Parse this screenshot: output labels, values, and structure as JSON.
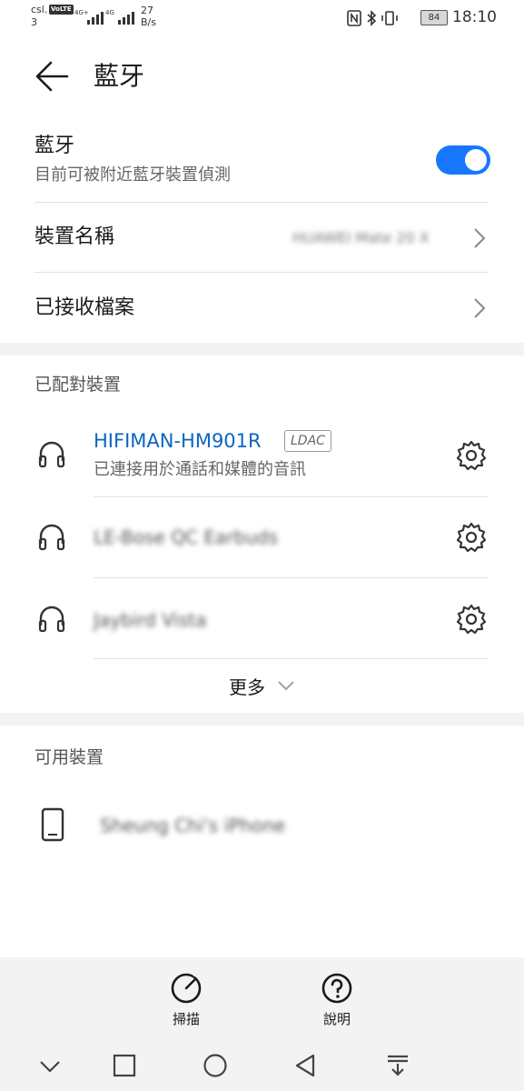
{
  "status_bar": {
    "carrier": "csl.",
    "carrier_sub": "3",
    "volte": "VoLTE",
    "net1": "4G+",
    "net2": "4G",
    "speed_value": "27",
    "speed_unit": "B/s",
    "battery": "84",
    "time": "18:10"
  },
  "header": {
    "title": "藍牙"
  },
  "bluetooth": {
    "title": "藍牙",
    "subtitle": "目前可被附近藍牙裝置偵測",
    "enabled": true,
    "accent_color": "#1677ff"
  },
  "device_name": {
    "label": "裝置名稱",
    "value": "HUAWEI Mate 20 X"
  },
  "received_files": {
    "label": "已接收檔案"
  },
  "paired": {
    "section_title": "已配對裝置",
    "devices": [
      {
        "name": "HIFIMAN-HM901R",
        "badge": "LDAC",
        "status": "已連接用於通話和媒體的音訊",
        "icon": "headset-icon"
      },
      {
        "name": "LE-Bose QC Earbuds",
        "icon": "headset-icon"
      },
      {
        "name": "Jaybird Vista",
        "icon": "headset-icon"
      }
    ],
    "more_label": "更多"
  },
  "available": {
    "section_title": "可用裝置",
    "devices": [
      {
        "name": "Sheung Chi's iPhone",
        "icon": "phone-icon"
      }
    ]
  },
  "actions": {
    "scan": "掃描",
    "help": "說明"
  },
  "nav": [
    "collapse-icon",
    "recents-icon",
    "home-icon",
    "back-icon",
    "notification-pull-icon"
  ]
}
